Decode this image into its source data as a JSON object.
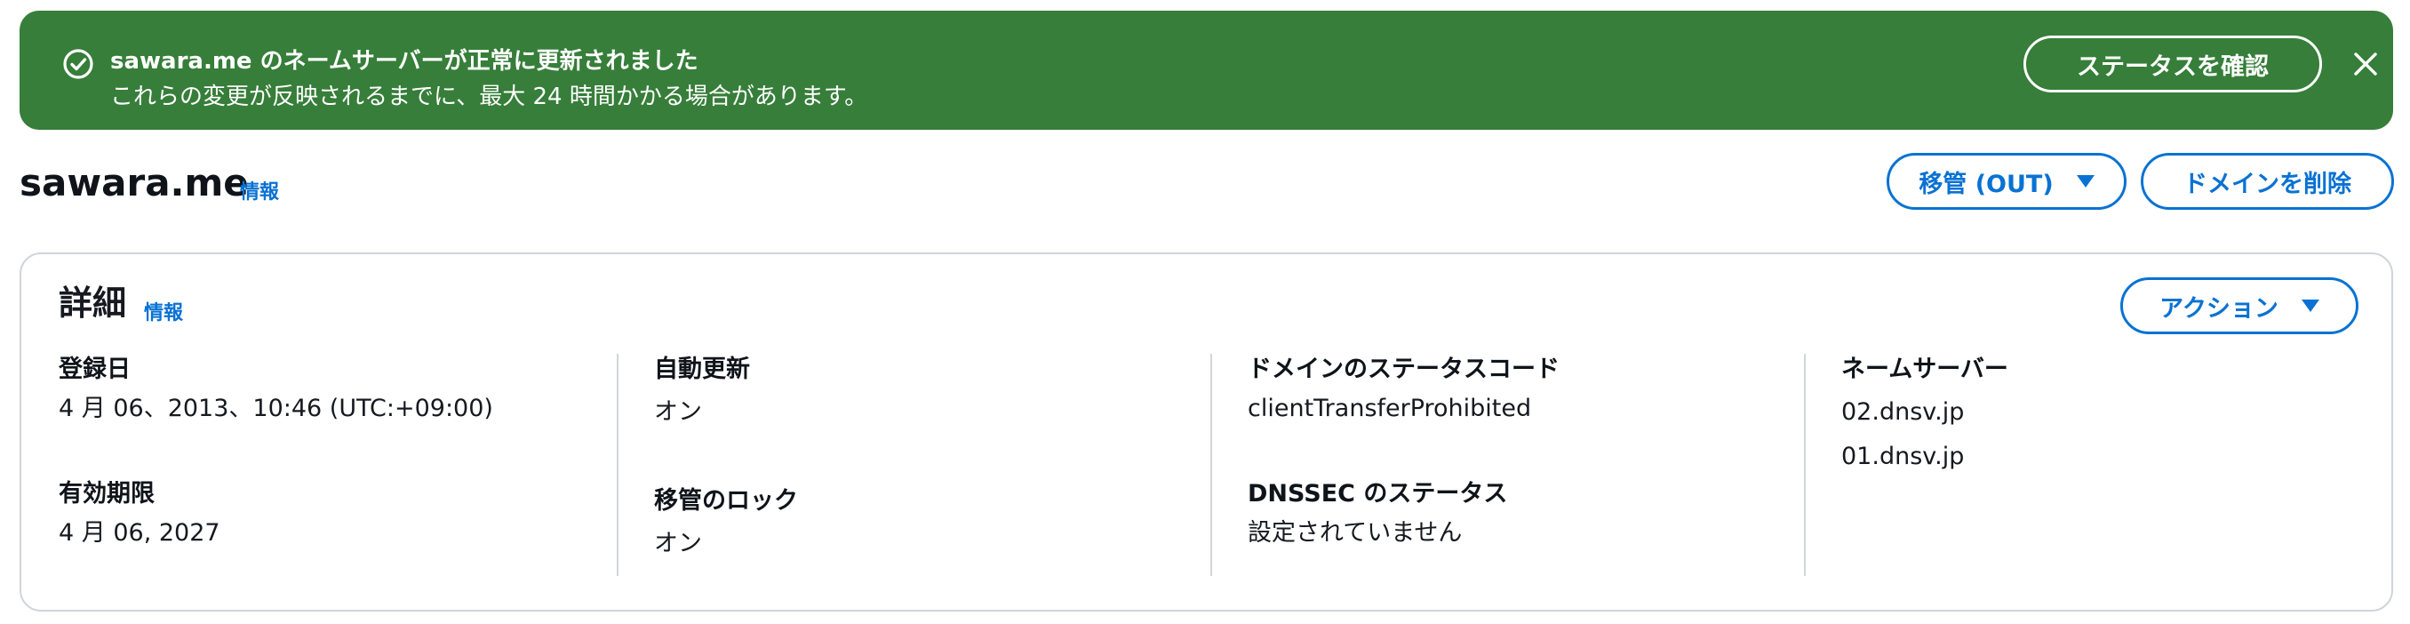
{
  "flashbar": {
    "title": "sawara.me のネームサーバーが正常に更新されました",
    "message": "これらの変更が反映されるまでに、最大 24 時間かかる場合があります。",
    "check_status_label": "ステータスを確認",
    "color": "#367e39",
    "status_icon": "check-circle-icon",
    "dismiss_icon": "close-icon"
  },
  "header": {
    "domain_name": "sawara.me",
    "info_label": "情報",
    "transfer_out_label": "移管 (OUT)",
    "delete_domain_label": "ドメインを削除"
  },
  "details": {
    "heading": "詳細",
    "info_label": "情報",
    "actions_label": "アクション",
    "registration_date": {
      "label": "登録日",
      "value": "4 月 06、2013、10:46 (UTC:+09:00)"
    },
    "expiration_date": {
      "label": "有効期限",
      "value": "4 月 06, 2027"
    },
    "auto_renew": {
      "label": "自動更新",
      "value": "オン"
    },
    "transfer_lock": {
      "label": "移管のロック",
      "value": "オン"
    },
    "domain_status_code": {
      "label": "ドメインのステータスコード",
      "value": "clientTransferProhibited"
    },
    "dnssec_status": {
      "label": "DNSSEC のステータス",
      "value": "設定されていません"
    },
    "name_servers": {
      "label": "ネームサーバー",
      "values": [
        "02.dnsv.jp",
        "01.dnsv.jp"
      ]
    }
  },
  "colors": {
    "accent": "#0972d3",
    "success": "#367e39",
    "border": "#d1d5db"
  }
}
